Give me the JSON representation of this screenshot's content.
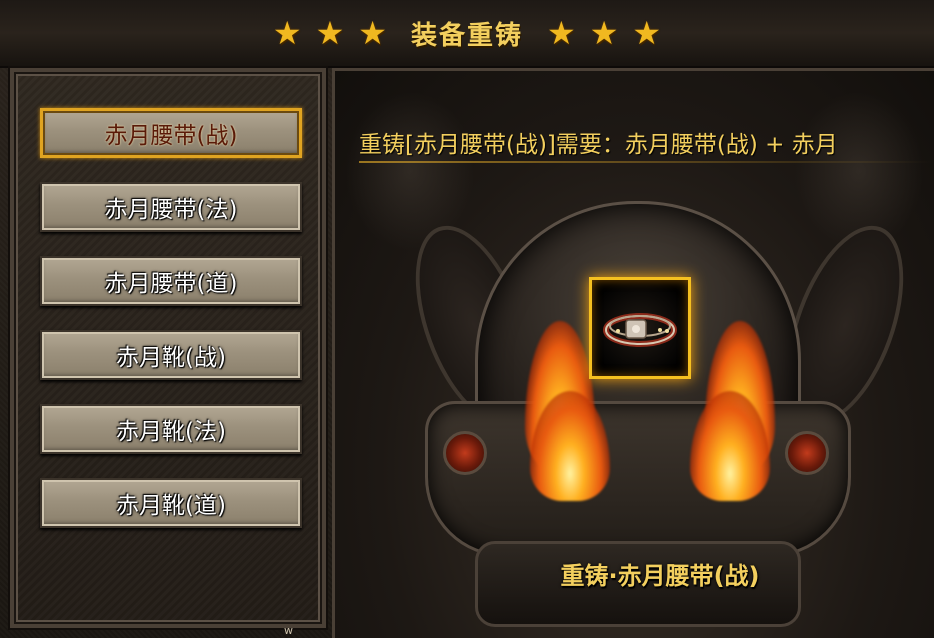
{
  "header": {
    "title": "装备重铸",
    "stars_left": [
      "★",
      "★",
      "★"
    ],
    "stars_right": [
      "★",
      "★",
      "★"
    ]
  },
  "item_list": [
    {
      "label": "赤月腰带(战)",
      "selected": true
    },
    {
      "label": "赤月腰带(法)",
      "selected": false
    },
    {
      "label": "赤月腰带(道)",
      "selected": false
    },
    {
      "label": "赤月靴(战)",
      "selected": false
    },
    {
      "label": "赤月靴(法)",
      "selected": false
    },
    {
      "label": "赤月靴(道)",
      "selected": false
    }
  ],
  "detail": {
    "requirement_text": "重铸[赤月腰带(战)]需要：赤月腰带(战) + 赤月",
    "forge_button_label": "重铸·赤月腰带(战)",
    "slot_item_icon": "belt-icon"
  },
  "footer": {
    "corner_mark": "w"
  },
  "colors": {
    "gold_text": "#f3cf5e",
    "selected_border": "#e0a421",
    "slot_border": "#f5c020"
  }
}
